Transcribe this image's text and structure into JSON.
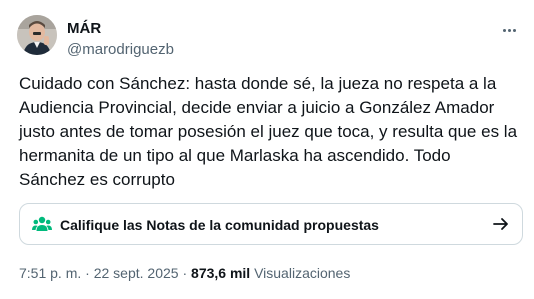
{
  "author": {
    "display_name": "MÁR",
    "handle": "@marodriguezb",
    "avatar": "avatar-portrait"
  },
  "tweet": {
    "text": "Cuidado con Sánchez: hasta donde sé, la jueza no respeta a la Audiencia Provincial, decide enviar a juicio a González Amador justo antes de tomar posesión el juez que toca, y resulta que es la hermanita de un tipo al que Marlaska ha ascendido. Todo Sánchez es corrupto"
  },
  "community_notes": {
    "label": "Califique las Notas de la comunidad propuestas",
    "icon": "community-notes-icon",
    "arrow_icon": "arrow-right-icon",
    "accent_color": "#00ba7c"
  },
  "meta": {
    "time": "7:51 p. m.",
    "separator": "·",
    "date": "22 sept. 2025",
    "views_count": "873,6 mil",
    "views_label": "Visualizaciones"
  },
  "more_icon": "more-horizontal-icon"
}
